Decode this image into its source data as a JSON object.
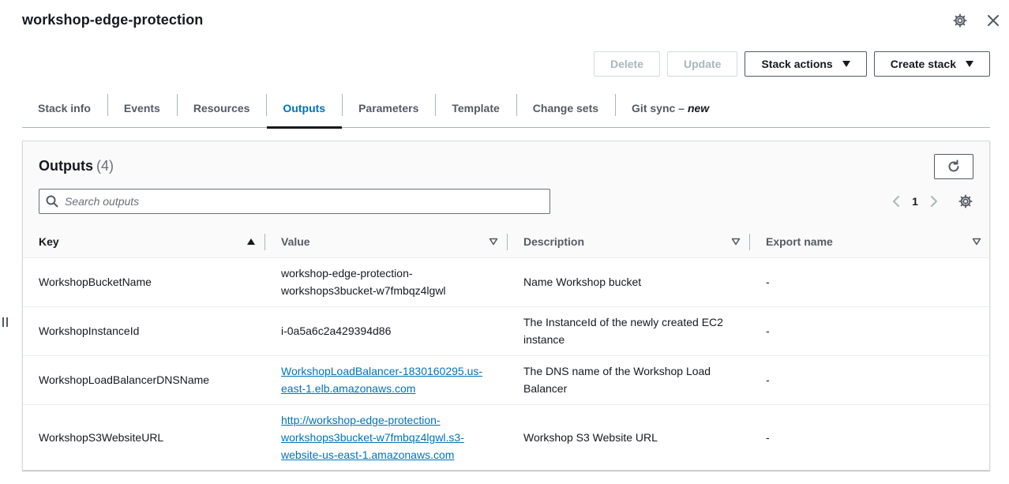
{
  "header": {
    "stack_name": "workshop-edge-protection",
    "settings_icon": "gear-icon",
    "close_icon": "close-icon"
  },
  "actions": {
    "delete_label": "Delete",
    "update_label": "Update",
    "stack_actions_label": "Stack actions",
    "create_stack_label": "Create stack"
  },
  "tabs": [
    {
      "label": "Stack info"
    },
    {
      "label": "Events"
    },
    {
      "label": "Resources"
    },
    {
      "label": "Outputs",
      "active": true
    },
    {
      "label": "Parameters"
    },
    {
      "label": "Template"
    },
    {
      "label": "Change sets"
    },
    {
      "label": "Git sync –",
      "badge": "new"
    }
  ],
  "outputs": {
    "title": "Outputs",
    "count": "(4)",
    "search_placeholder": "Search outputs",
    "page": "1",
    "columns": [
      "Key",
      "Value",
      "Description",
      "Export name"
    ],
    "rows": [
      {
        "key": "WorkshopBucketName",
        "value": "workshop-edge-protection-workshops3bucket-w7fmbqz4lgwl",
        "value_is_link": false,
        "description": "Name Workshop bucket",
        "export": "-"
      },
      {
        "key": "WorkshopInstanceId",
        "value": "i-0a5a6c2a429394d86",
        "value_is_link": false,
        "description": "The InstanceId of the newly created EC2 instance",
        "export": "-"
      },
      {
        "key": "WorkshopLoadBalancerDNSName",
        "value": "WorkshopLoadBalancer-1830160295.us-east-1.elb.amazonaws.com",
        "value_is_link": true,
        "description": "The DNS name of the Workshop Load Balancer",
        "export": "-"
      },
      {
        "key": "WorkshopS3WebsiteURL",
        "value": "http://workshop-edge-protection-workshops3bucket-w7fmbqz4lgwl.s3-website-us-east-1.amazonaws.com",
        "value_is_link": true,
        "description": "Workshop S3 Website URL",
        "export": "-"
      }
    ]
  },
  "colors": {
    "accent": "#0073bb",
    "text": "#16191f",
    "muted": "#545b64"
  }
}
